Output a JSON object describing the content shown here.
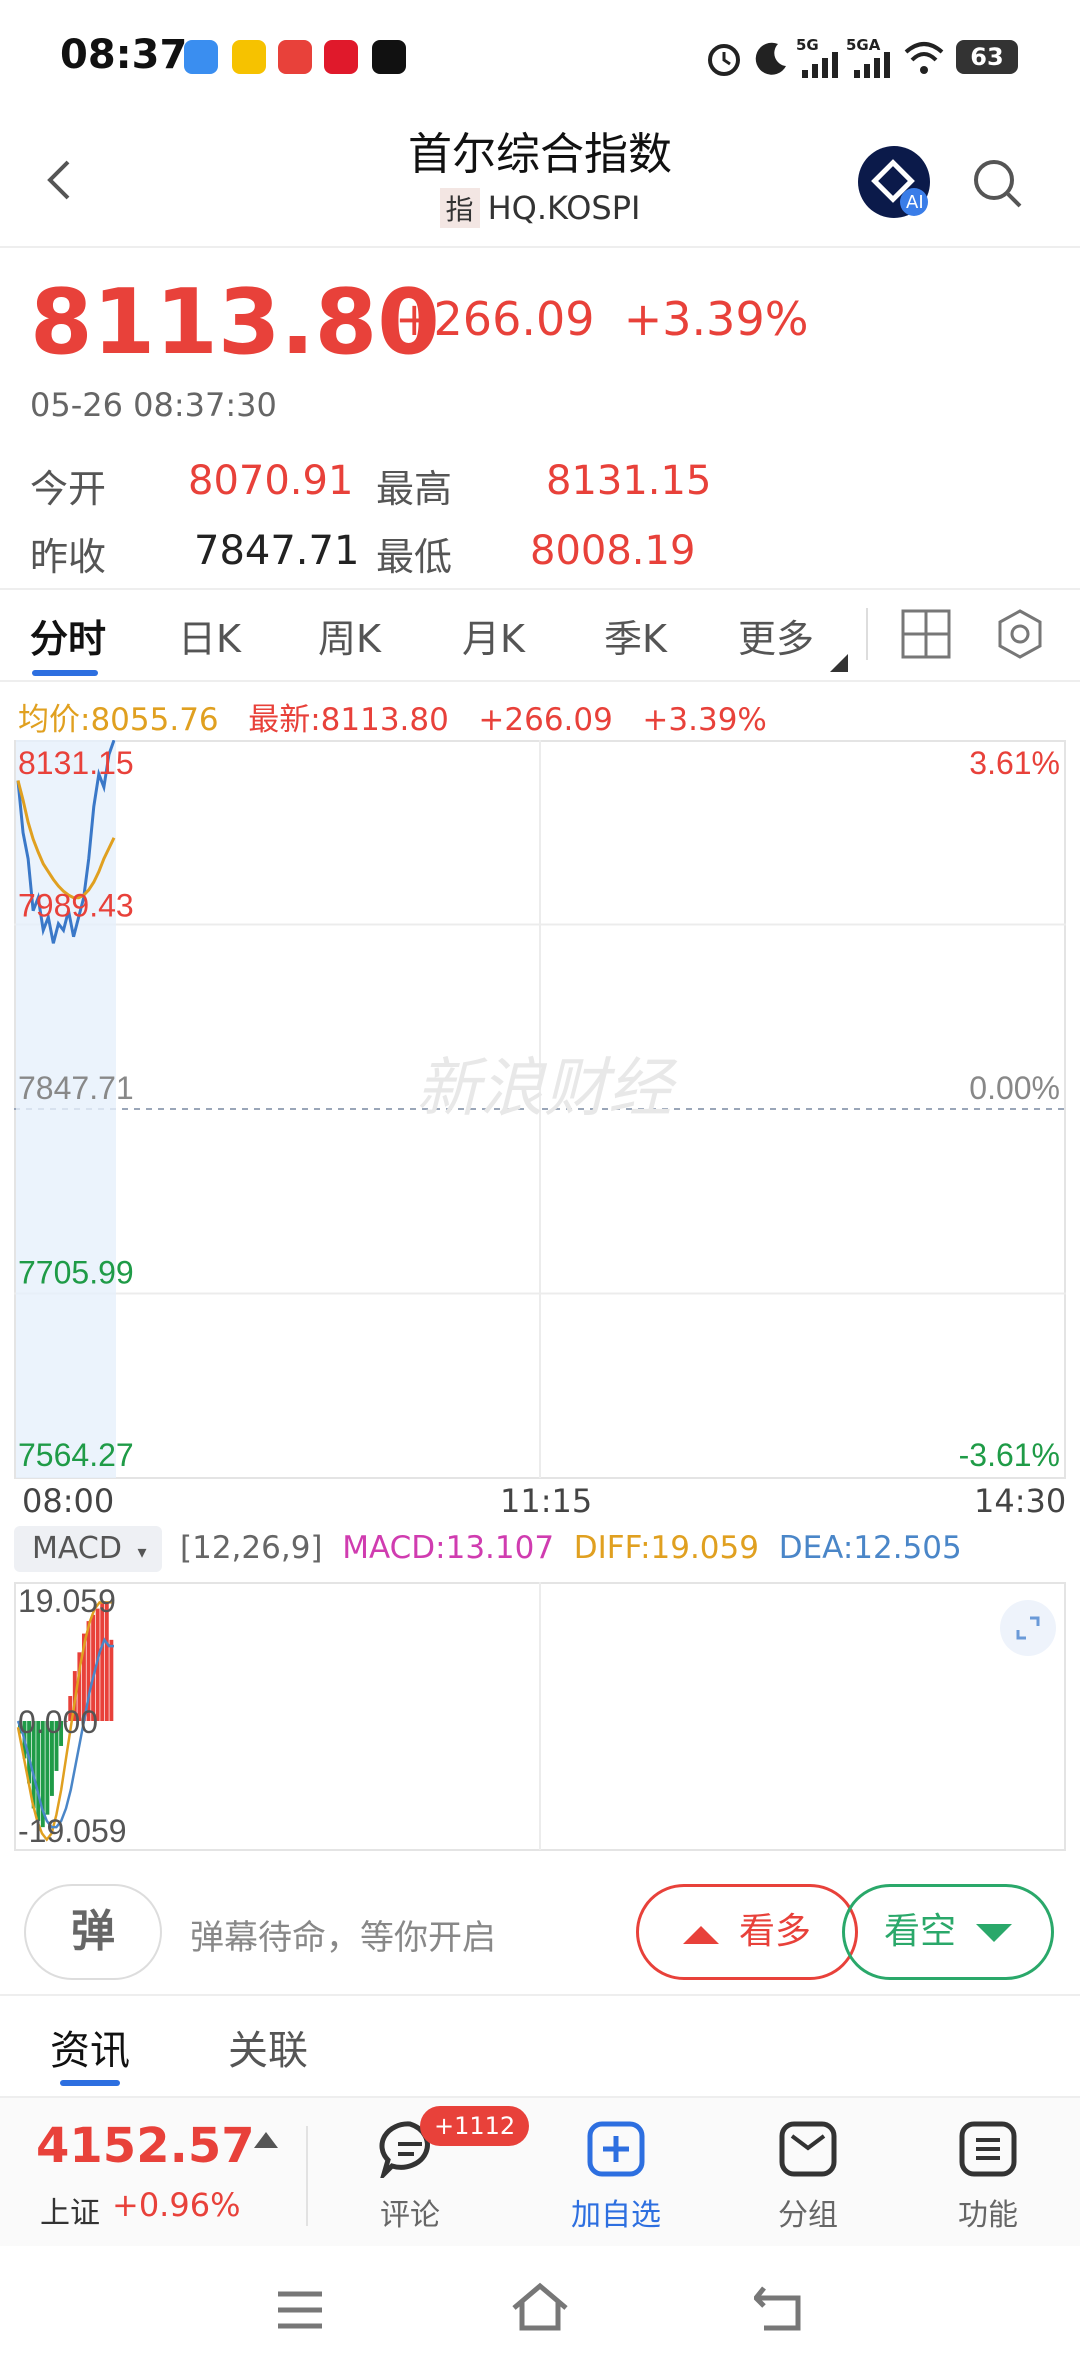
{
  "status_bar": {
    "time": "08:37",
    "battery": "63",
    "signal_1": "5G",
    "signal_2": "5GA"
  },
  "header": {
    "title": "首尔综合指数",
    "code_tag": "指",
    "code": "HQ.KOSPI",
    "ai_badge": "AI"
  },
  "quote": {
    "price": "8113.80",
    "change": "+266.09",
    "change_pct": "+3.39%",
    "timestamp": "05-26 08:37:30",
    "open_label": "今开",
    "open": "8070.91",
    "high_label": "最高",
    "high": "8131.15",
    "prev_close_label": "昨收",
    "prev_close": "7847.71",
    "low_label": "最低",
    "low": "8008.19"
  },
  "tabs": [
    "分时",
    "日K",
    "周K",
    "月K",
    "季K",
    "更多"
  ],
  "chart_info": {
    "avg": "均价:8055.76",
    "latest": "最新:8113.80",
    "change": "+266.09",
    "change_pct": "+3.39%"
  },
  "chart_data": {
    "type": "line",
    "title": "",
    "y_labels_left": [
      "8131.15",
      "7989.43",
      "7847.71",
      "7705.99",
      "7564.27"
    ],
    "y_labels_right": [
      "3.61%",
      "0.00%",
      "-3.61%"
    ],
    "x_labels": [
      "08:00",
      "11:15",
      "14:30"
    ],
    "ylim": [
      7564.27,
      8131.15
    ],
    "series": [
      {
        "values": [
          8100,
          8060,
          8040,
          8000,
          8010,
          7985,
          7995,
          7975,
          7990,
          7985,
          8000,
          7980,
          7995,
          8010,
          8040,
          8080,
          8105,
          8095,
          8120,
          8131
        ]
      },
      {
        "values": [
          8100,
          8085,
          8068,
          8055,
          8045,
          8036,
          8030,
          8024,
          8019,
          8015,
          8012,
          8010,
          8010,
          8012,
          8016,
          8022,
          8030,
          8040,
          8048,
          8056
        ]
      }
    ],
    "watermark": "新浪财经"
  },
  "macd": {
    "selector": "MACD",
    "params": "[12,26,9]",
    "macd": "MACD:13.107",
    "diff": "DIFF:19.059",
    "dea": "DEA:12.505",
    "y_labels": [
      "19.059",
      "0.000",
      "-19.059"
    ],
    "ylim": [
      -19.059,
      19.059
    ],
    "bars": [
      -2,
      -6,
      -10,
      -14,
      -16,
      -17,
      -15,
      -12,
      -8,
      -4,
      0,
      4,
      8,
      11,
      14,
      16,
      17,
      18,
      19,
      19,
      13
    ],
    "diff_values": [
      -1,
      -5,
      -9,
      -13,
      -16,
      -18,
      -19,
      -18,
      -15,
      -11,
      -6,
      -1,
      4,
      9,
      13,
      16,
      18,
      19,
      19,
      19,
      19
    ],
    "dea_values": [
      0,
      -2,
      -5,
      -8,
      -11,
      -14,
      -16,
      -17,
      -17,
      -16,
      -14,
      -11,
      -7,
      -3,
      1,
      5,
      8,
      11,
      13,
      12,
      12
    ]
  },
  "danmaku": {
    "button": "弹",
    "hint": "弹幕待命，等你开启",
    "bull": "看多",
    "bear": "看空"
  },
  "news_tabs": [
    "资讯",
    "关联"
  ],
  "bottom_bar": {
    "index_value": "4152.57",
    "index_name": "上证",
    "index_change": "+0.96%",
    "comment_label": "评论",
    "comment_badge": "+1112",
    "add_label": "加自选",
    "group_label": "分组",
    "func_label": "功能"
  }
}
